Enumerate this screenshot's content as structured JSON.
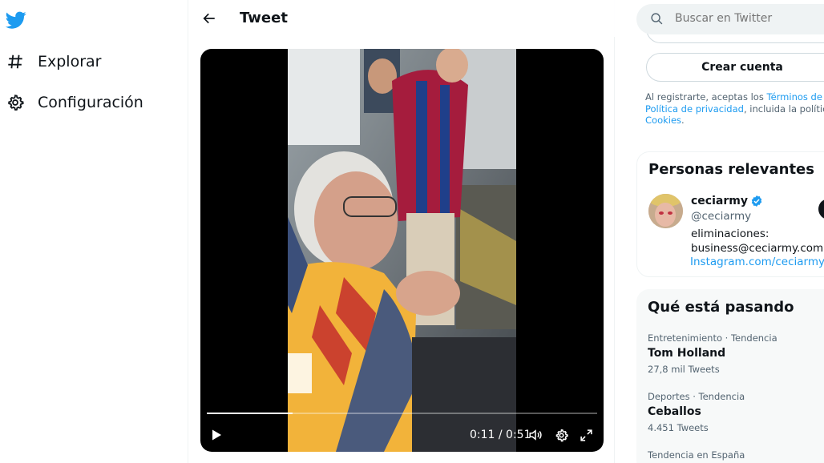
{
  "nav": {
    "items": [
      {
        "label": "Explorar",
        "icon": "hashtag-icon"
      },
      {
        "label": "Configuración",
        "icon": "gear-icon"
      }
    ]
  },
  "header": {
    "title": "Tweet"
  },
  "video": {
    "time_display": "0:11 / 0:51",
    "progress": 0.22
  },
  "search": {
    "placeholder": "Buscar en Twitter"
  },
  "signup": {
    "create_label": "Crear cuenta",
    "legal_prefix": "Al registrarte, aceptas los ",
    "terms_link": "Términos de serv",
    "privacy_link": "Política de privacidad",
    "legal_middle": ", incluida la política c",
    "cookies_link": "Cookies",
    "legal_end": "."
  },
  "people": {
    "title": "Personas relevantes",
    "user": {
      "name": "ceciarmy",
      "handle": "@ceciarmy",
      "bio_line1": "eliminaciones:",
      "bio_line2": "business@ceciarmy.com síg",
      "link": "Instagram.com/ceciarmy"
    }
  },
  "trends": {
    "title": "Qué está pasando",
    "items": [
      {
        "meta": "Entretenimiento · Tendencia",
        "name": "Tom Holland",
        "count": "27,8 mil Tweets"
      },
      {
        "meta": "Deportes · Tendencia",
        "name": "Ceballos",
        "count": "4.451 Tweets"
      },
      {
        "meta": "Tendencia en España",
        "name": "",
        "count": ""
      }
    ]
  },
  "colors": {
    "brand": "#1d9bf0",
    "text": "#0f1419",
    "muted": "#536471"
  }
}
